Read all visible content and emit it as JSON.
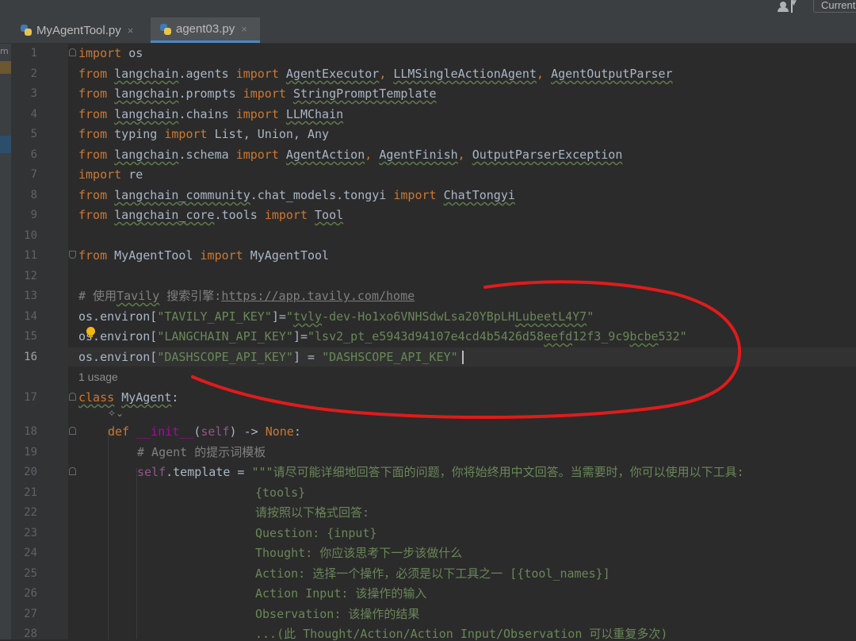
{
  "toolbar": {
    "current_file_label": "Current"
  },
  "tabs": [
    {
      "label": "MyAgentTool.py",
      "close": "×",
      "active": false
    },
    {
      "label": "agent03.py",
      "close": "×",
      "active": true
    }
  ],
  "editor": {
    "usage_hint": "1 usage",
    "line_numbers": [
      "1",
      "2",
      "3",
      "4",
      "5",
      "6",
      "7",
      "8",
      "9",
      "10",
      "11",
      "12",
      "13",
      "14",
      "15",
      "16",
      "17",
      "18",
      "19",
      "20",
      "21",
      "22",
      "23",
      "24",
      "25",
      "26",
      "27",
      "28"
    ],
    "current_line": "16",
    "code": {
      "l1": [
        "import",
        " os"
      ],
      "l2": [
        "from",
        " ",
        "langchain",
        ".agents ",
        "import",
        " ",
        "AgentExecutor",
        ", ",
        "LLMSingleActionAgent",
        ", ",
        "AgentOutputParser"
      ],
      "l3": [
        "from",
        " ",
        "langchain",
        ".prompts ",
        "import",
        " ",
        "StringPromptTemplate"
      ],
      "l4": [
        "from",
        " ",
        "langchain",
        ".chains ",
        "import",
        " ",
        "LLMChain"
      ],
      "l5": [
        "from",
        " typing ",
        "import",
        " List, Union, Any"
      ],
      "l6": [
        "from",
        " ",
        "langchain",
        ".schema ",
        "import",
        " ",
        "AgentAction",
        ", ",
        "AgentFinish",
        ", ",
        "OutputParserException"
      ],
      "l7": [
        "import",
        " re"
      ],
      "l8": [
        "from",
        " ",
        "langchain_community",
        ".chat_models.tongyi ",
        "import",
        " ",
        "ChatTongyi"
      ],
      "l9": [
        "from",
        " ",
        "langchain_core",
        ".tools ",
        "import",
        " ",
        "Tool"
      ],
      "l11": [
        "from",
        " MyAgentTool ",
        "import",
        " MyAgentTool"
      ],
      "l13": [
        "# 使用",
        "Tavily",
        " 搜索引擎:",
        "https://app.tavily.com/home"
      ],
      "l14": [
        "os.environ[",
        "\"TAVILY_API_KEY\"",
        "]=",
        "\"",
        "tvly",
        "-dev-Ho1xo6VNHSdwLsa20YBpLH",
        "LubeetL4Y7",
        "\""
      ],
      "l15": [
        "os.environ[",
        "\"LANGCHAIN_API_KEY\"",
        "]=",
        "\"lsv2_pt_e5943d94107e4cd4b5426d58",
        "eefd",
        "12f3_9c9",
        "bcbe",
        "532\""
      ],
      "l16": [
        "os.environ[",
        "\"DASHSCOPE_API_KEY\"",
        "] = ",
        "\"DASHSCOPE_API_KEY\""
      ],
      "l17": [
        "class",
        " ",
        "MyAgent",
        ":"
      ],
      "l18": [
        "def",
        " ",
        "__init__",
        "(",
        "self",
        ") -> ",
        "None",
        ":"
      ],
      "l19": [
        "# Agent 的提示词模板"
      ],
      "l20": [
        "self",
        ".template = ",
        "\"\"\"请尽可能详细地回答下面的问题，你将始终用中文回答。当需要时，你可以使用以下工具:"
      ],
      "l21": [
        "{tools}"
      ],
      "l22": [
        "请按照以下格式回答:"
      ],
      "l23": [
        "Question: {input}"
      ],
      "l24": [
        "Thought: 你应该思考下一步该做什么"
      ],
      "l25": [
        "Action: 选择一个操作，必须是以下工具之一 [{tool_names}]"
      ],
      "l26": [
        "Action Input: 该操作的输入"
      ],
      "l27": [
        "Observation: 该操作的结果"
      ],
      "l28": [
        "...(此 Thought/Action/Action Input/Observation 可以重复多次)"
      ]
    }
  },
  "annotation": {
    "color": "#e01b1b"
  }
}
